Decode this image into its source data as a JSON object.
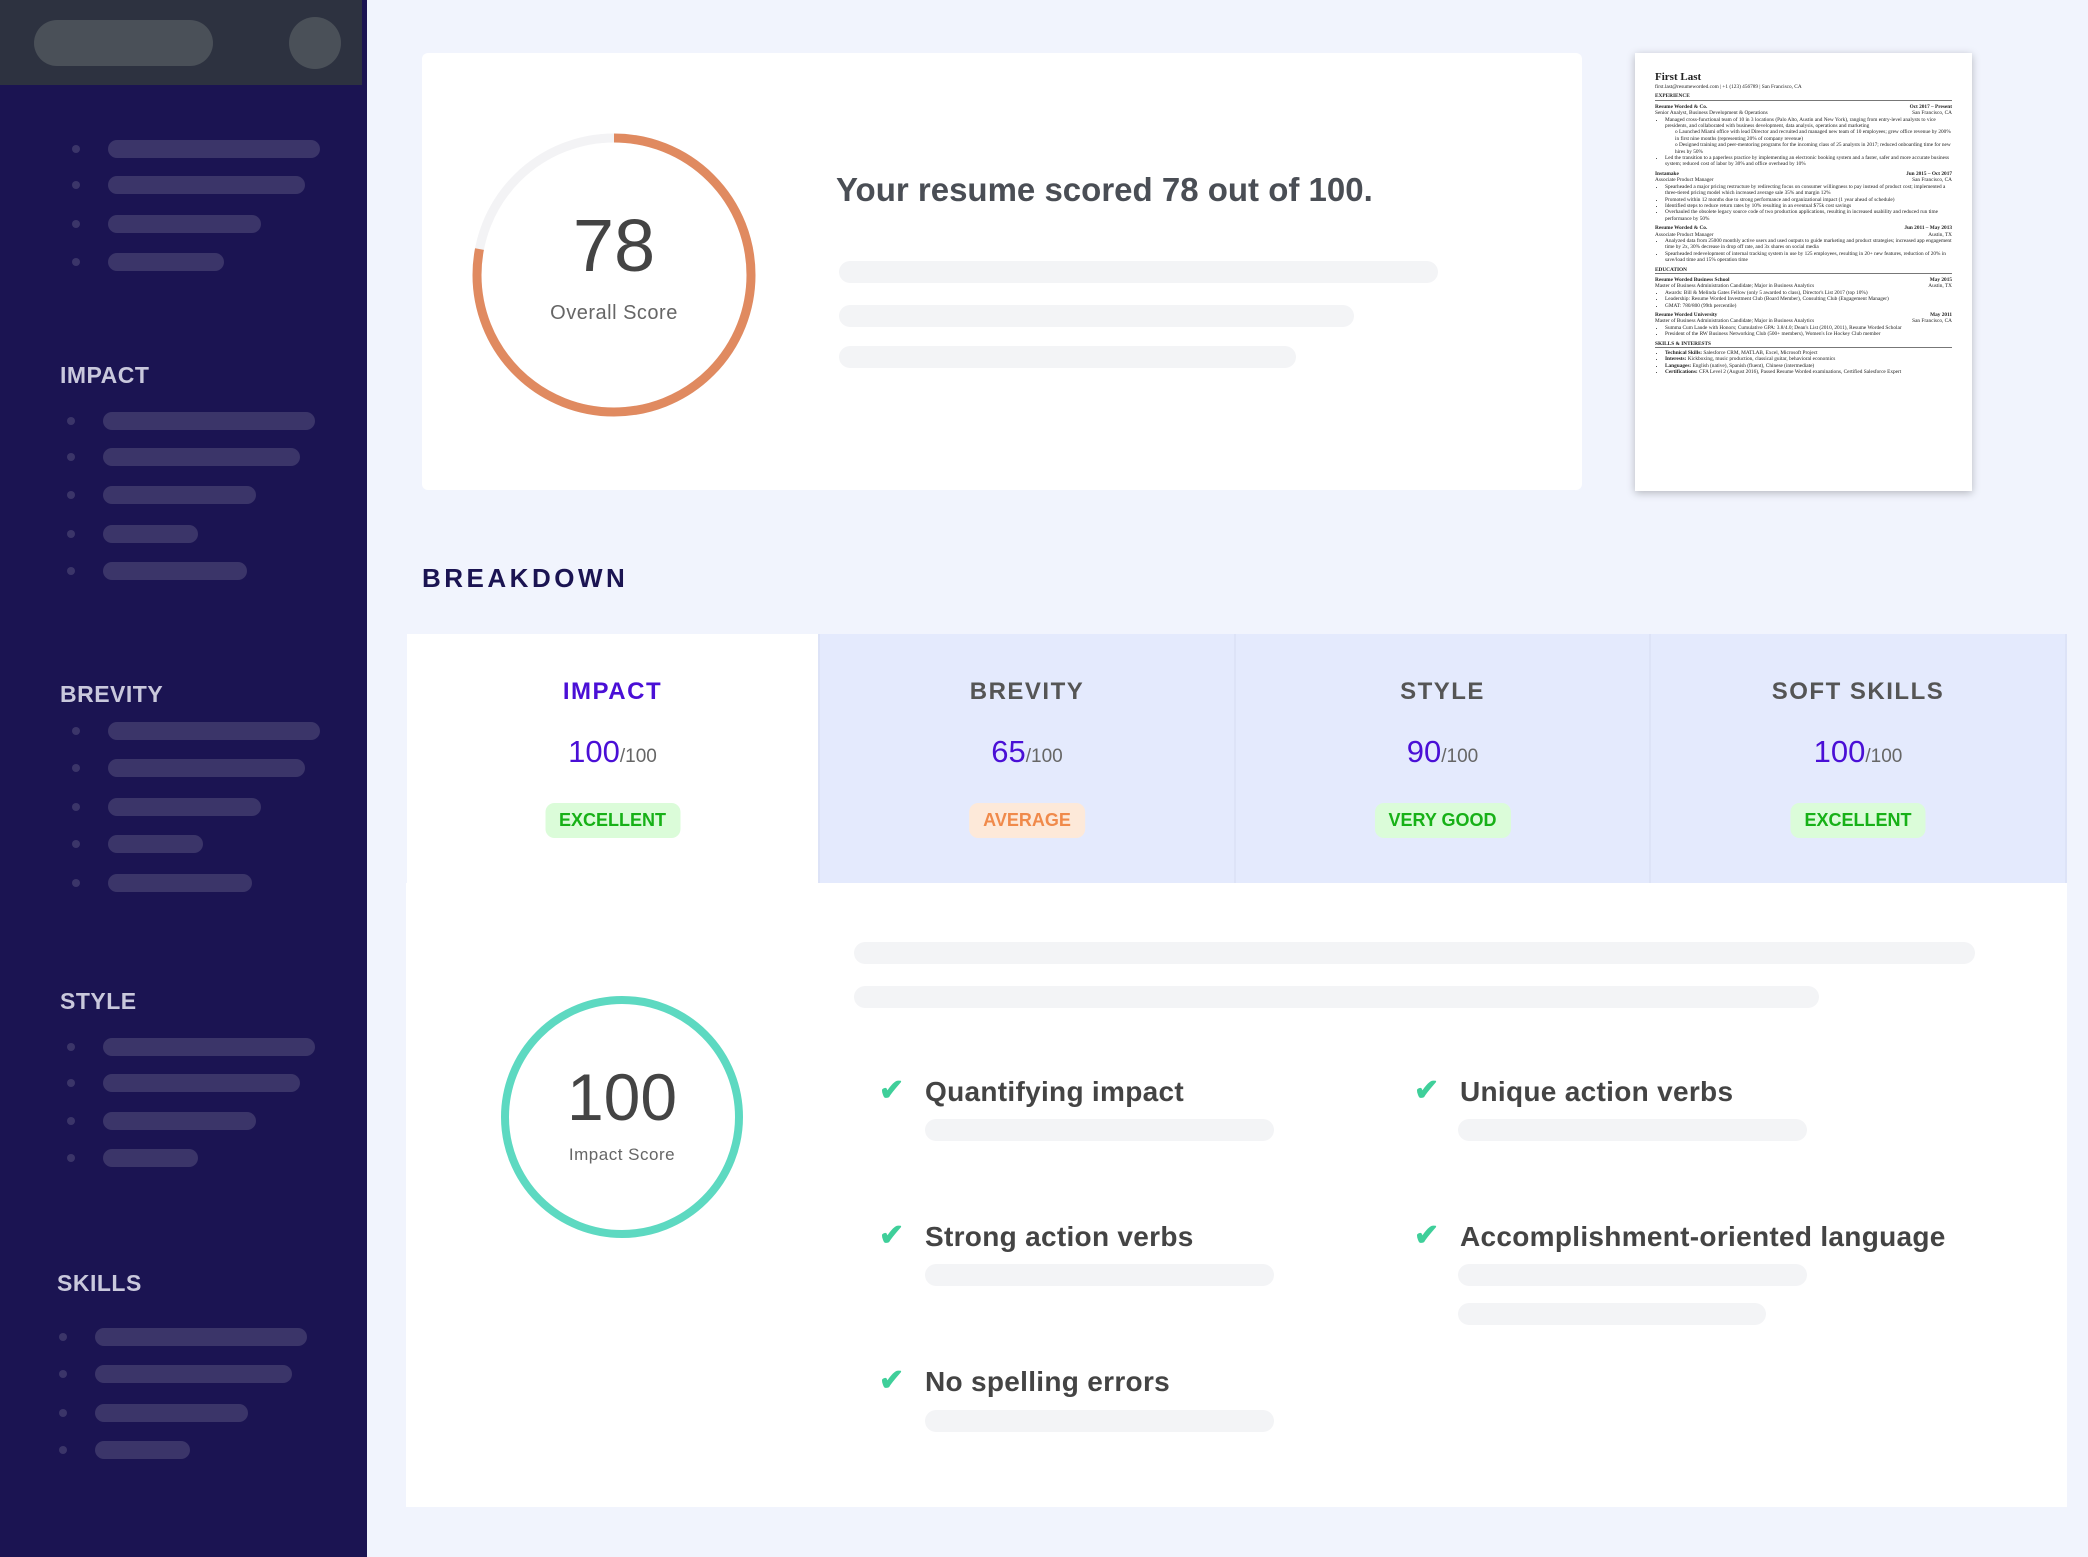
{
  "sidebar": {
    "sections": [
      {
        "label": "IMPACT"
      },
      {
        "label": "BREVITY"
      },
      {
        "label": "STYLE"
      },
      {
        "label": "SKILLS"
      }
    ]
  },
  "overview": {
    "score": "78",
    "score_value": 78,
    "score_max": 100,
    "score_label": "Overall Score",
    "headline": "Your resume scored 78 out of 100.",
    "ring_color": "#e08a60"
  },
  "resume_preview": {
    "name": "First Last",
    "contact": "first.last@resumeworded.com | +1 (123) 456789 | San Francisco, CA",
    "experience_heading": "EXPERIENCE",
    "jobs": [
      {
        "company": "Resume Worded & Co.",
        "dates": "Oct 2017 – Present",
        "title": "Senior Analyst, Business Development & Operations",
        "location": "San Francisco, CA",
        "bullets": [
          "Managed cross-functional team of 10 in 3 locations (Palo Alto, Austin and New York), ranging from entry-level analysts to vice presidents, and collaborated with business development, data analysis, operations and marketing",
          "o Launched Miami office with lead Director and recruited and managed new team of 10 employees; grew office revenue by 200% in first nine months (representing 20% of company revenue)",
          "o Designed training and peer-mentoring programs for the incoming class of 25 analysts in 2017; reduced onboarding time for new hires by 50%",
          "Led the transition to a paperless practice by implementing an electronic booking system and a faster, safer and more accurate business system; reduced cost of labor by 30% and office overhead by 10%"
        ]
      },
      {
        "company": "Instamake",
        "dates": "Jun 2015 – Oct 2017",
        "title": "Associate Product Manager",
        "location": "San Francisco, CA",
        "bullets": [
          "Spearheaded a major pricing restructure by redirecting focus on consumer willingness to pay instead of product cost; implemented a three-tiered pricing model which increased average sale 35% and margin 12%",
          "Promoted within 12 months due to strong performance and organizational impact (1 year ahead of schedule)",
          "Identified steps to reduce return rates by 10% resulting in an eventual $75k cost savings",
          "Overhauled the obsolete legacy source code of two production applications, resulting in increased usability and reduced run time performance by 50%"
        ]
      },
      {
        "company": "Resume Worded & Co.",
        "dates": "Jun 2011 – May 2013",
        "title": "Associate Product Manager",
        "location": "Austin, TX",
        "bullets": [
          "Analyzed data from 25000 monthly active users and used outputs to guide marketing and product strategies; increased app engagement time by 2x, 30% decrease in drop off rate, and 3x shares on social media",
          "Spearheaded redevelopment of internal tracking system in use by 125 employees, resulting in 20+ new features, reduction of 20% in save/load time and 15% operation time"
        ]
      }
    ],
    "education_heading": "EDUCATION",
    "schools": [
      {
        "school": "Resume Worded Business School",
        "dates": "May 2015",
        "degree": "Master of Business Administration Candidate; Major in Business Analytics",
        "location": "Austin, TX",
        "bullets": [
          "Awards: Bill & Melinda Gates Fellow (only 5 awarded to class), Director's List 2017 (top 10%)",
          "Leadership: Resume Worded Investment Club (Board Member), Consulting Club (Engagement Manager)",
          "GMAT: 780/800 (99th percentile)"
        ]
      },
      {
        "school": "Resume Worded University",
        "dates": "May 2011",
        "degree": "Master of Business Administration Candidate; Major in Business Analytics",
        "location": "San Francisco, CA",
        "bullets": [
          "Summa Cum Laude with Honors; Cumulative GPA: 3.8/4.0; Dean's List (2010, 2011), Resume Worded Scholar",
          "President of the RW Business Networking Club (500+ members), Women's Ice Hockey Club member"
        ]
      }
    ],
    "skills_heading": "SKILLS & INTERESTS",
    "skills": [
      {
        "k": "Technical Skills:",
        "v": "Salesforce CRM, MATLAB, Excel, Microsoft Project"
      },
      {
        "k": "Interests:",
        "v": "Kickboxing, music production, classical guitar, behavioral economics"
      },
      {
        "k": "Languages:",
        "v": "English (native), Spanish (fluent), Chinese (intermediate)"
      },
      {
        "k": "Certifications:",
        "v": "CFA Level 2 (August 2016), Passed Resume Worded examinations, Certified Salesforce Expert"
      }
    ]
  },
  "breakdown": {
    "heading": "BREAKDOWN",
    "tabs": [
      {
        "label": "IMPACT",
        "score": "100",
        "max": "/100",
        "rating": "EXCELLENT",
        "active": true
      },
      {
        "label": "BREVITY",
        "score": "65",
        "max": "/100",
        "rating": "AVERAGE",
        "active": false
      },
      {
        "label": "STYLE",
        "score": "90",
        "max": "/100",
        "rating": "VERY GOOD",
        "active": false
      },
      {
        "label": "SOFT SKILLS",
        "score": "100",
        "max": "/100",
        "rating": "EXCELLENT",
        "active": false
      }
    ],
    "detail": {
      "score": "100",
      "score_value": 100,
      "score_label": "Impact Score",
      "ring_color": "#5dd9c1",
      "checks": [
        {
          "label": "Quantifying impact",
          "icon": "check-icon"
        },
        {
          "label": "Unique action verbs",
          "icon": "check-icon"
        },
        {
          "label": "Strong action verbs",
          "icon": "check-icon"
        },
        {
          "label": "Accomplishment-oriented language",
          "icon": "check-icon"
        },
        {
          "label": "No spelling errors",
          "icon": "check-icon"
        }
      ]
    }
  },
  "colors": {
    "sidebar": "#1b1452",
    "accent": "#4a0fd6",
    "excellent": "#17b117",
    "average": "#f08a4b"
  }
}
